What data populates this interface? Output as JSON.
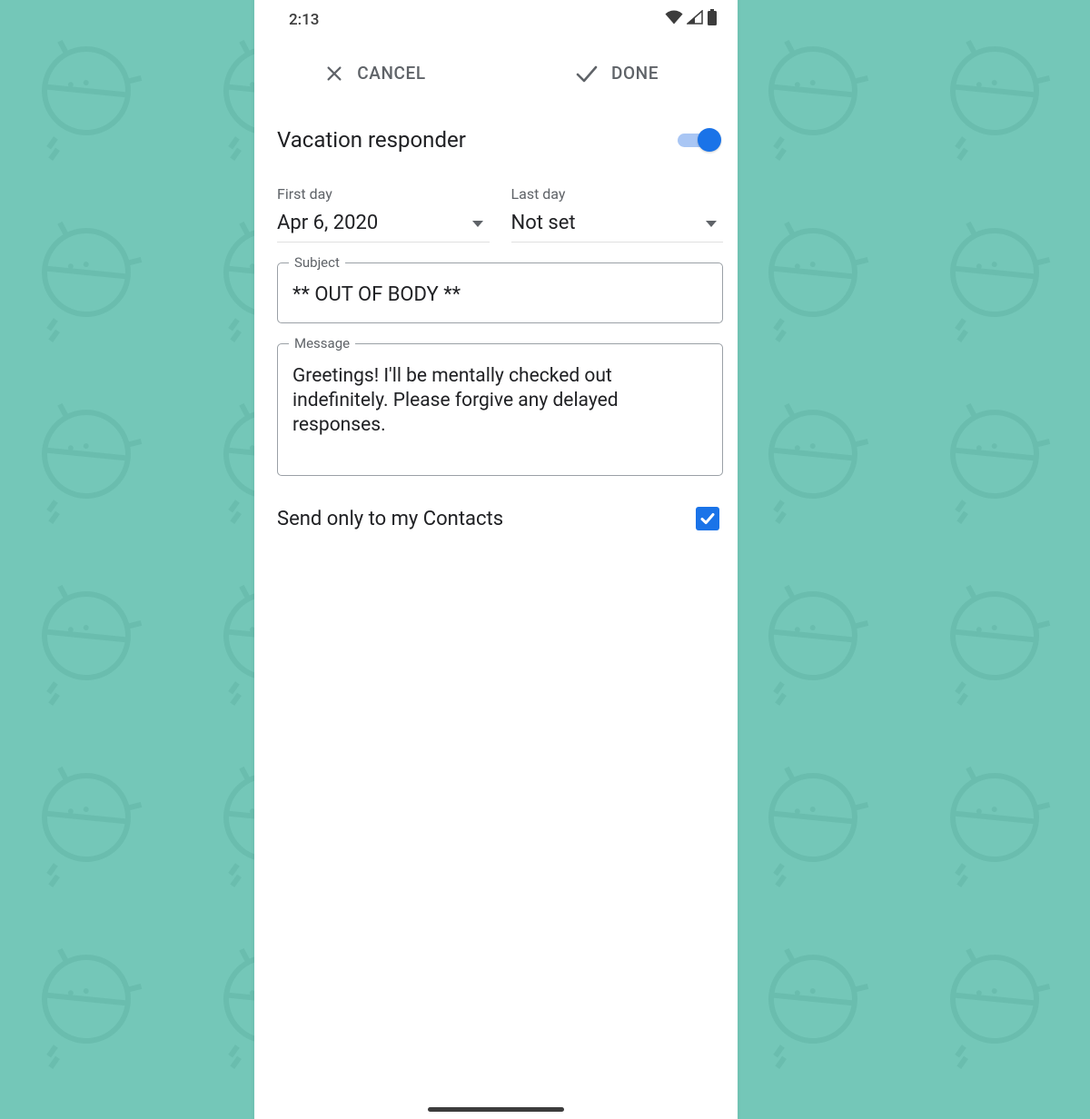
{
  "status": {
    "time": "2:13"
  },
  "actions": {
    "cancel": "CANCEL",
    "done": "DONE"
  },
  "page": {
    "title": "Vacation responder"
  },
  "toggle": {
    "on": true
  },
  "dates": {
    "first_label": "First day",
    "first_value": "Apr 6, 2020",
    "last_label": "Last day",
    "last_value": "Not set"
  },
  "subject": {
    "label": "Subject",
    "value": "** OUT OF BODY **"
  },
  "message": {
    "label": "Message",
    "value": "Greetings! I'll be mentally checked out indefinitely. Please forgive any delayed responses."
  },
  "contacts": {
    "label": "Send only to my Contacts",
    "checked": true
  }
}
